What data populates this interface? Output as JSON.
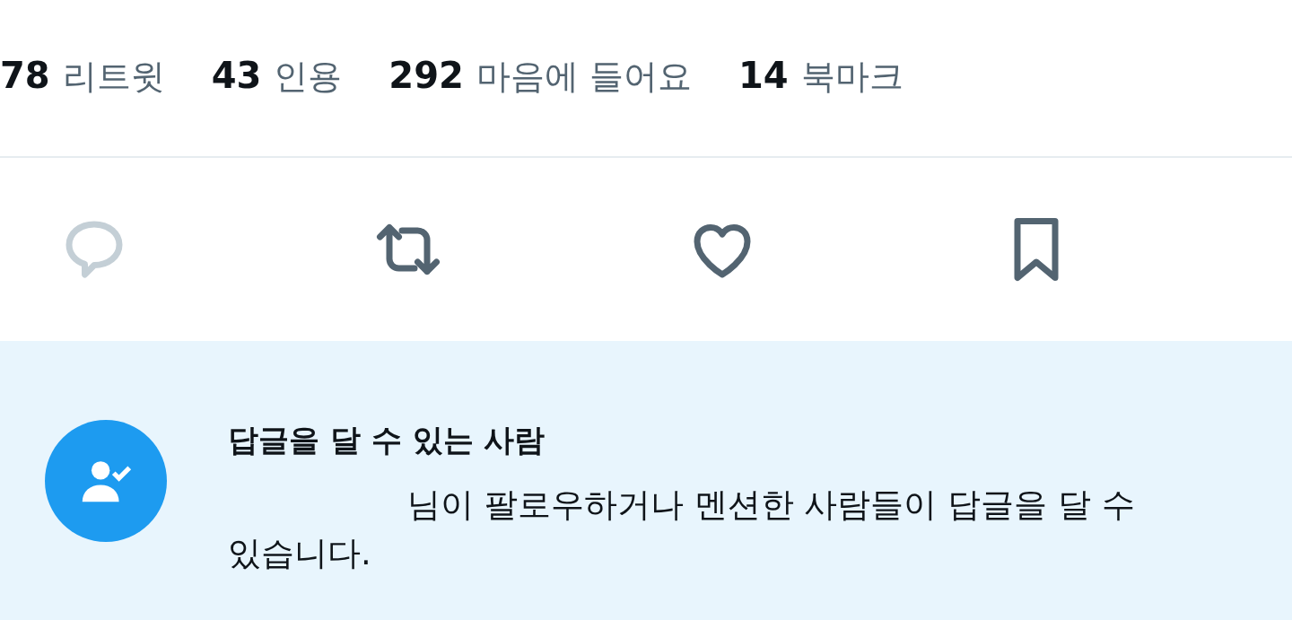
{
  "stats": [
    {
      "count": "78",
      "label": "리트윗"
    },
    {
      "count": "43",
      "label": "인용"
    },
    {
      "count": "292",
      "label": "마음에 들어요"
    },
    {
      "count": "14",
      "label": "북마크"
    }
  ],
  "actions": [
    {
      "kind": "reply",
      "disabled": true
    },
    {
      "kind": "retweet",
      "disabled": false
    },
    {
      "kind": "like",
      "disabled": false
    },
    {
      "kind": "bookmark",
      "disabled": false
    }
  ],
  "reply_notice": {
    "title": "답글을 달 수 있는 사람",
    "text": "님이 팔로우하거나 멘션한 사람들이 답글을 달 수 있습니다."
  }
}
